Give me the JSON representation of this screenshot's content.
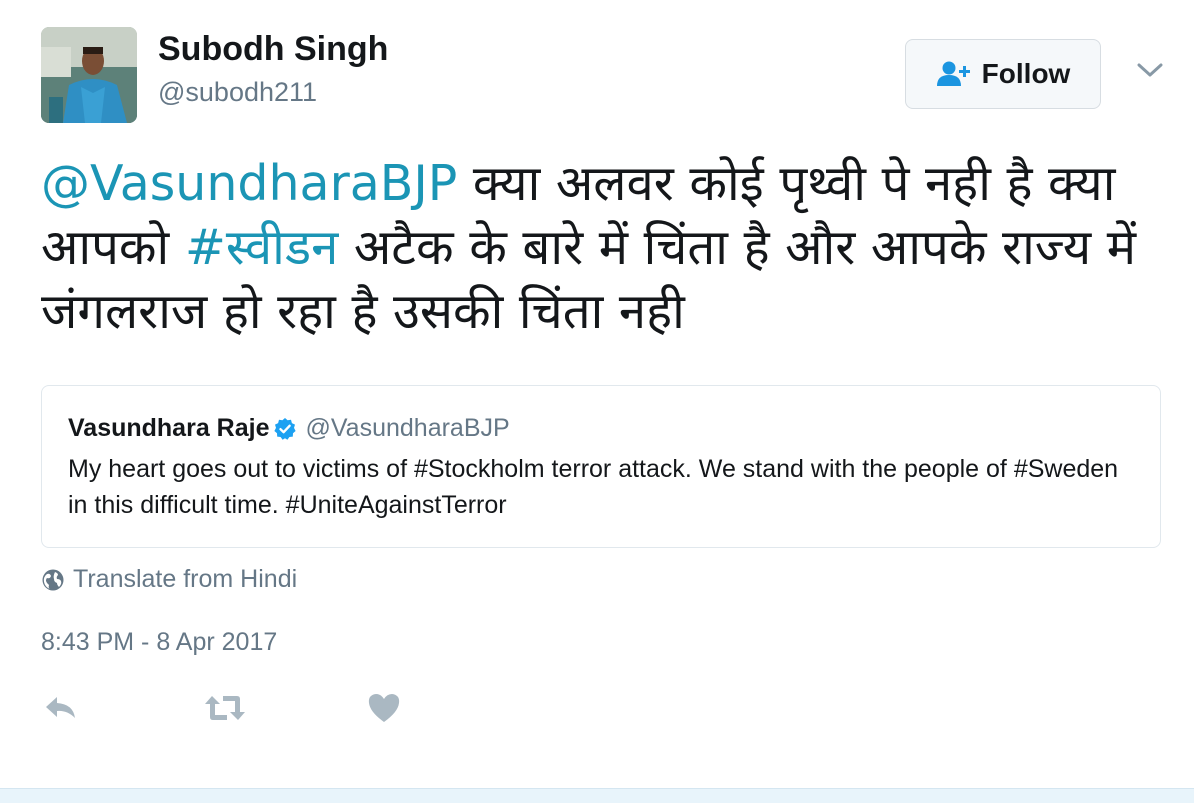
{
  "author": {
    "name": "Subodh Singh",
    "handle": "@subodh211"
  },
  "follow_button": {
    "label": "Follow",
    "icon": "add-user-icon"
  },
  "menu_icon": "chevron-down-icon",
  "tweet": {
    "mention": "@VasundharaBJP",
    "text_part1": " क्या अलवर कोई पृथ्वी पे नही है क्या आपको ",
    "hashtag": "#स्वीडन",
    "text_part2": " अटैक के बारे में चिंता है और आपके राज्य में जंगलराज हो रहा है उसकी चिंता नही"
  },
  "quoted_tweet": {
    "name": "Vasundhara Raje",
    "verified_icon": "verified-badge-icon",
    "handle": "@VasundharaBJP",
    "text": "My heart goes out to victims of #Stockholm terror attack. We stand with  the people of #Sweden in this difficult time. #UniteAgainstTerror"
  },
  "translate": {
    "icon": "globe-icon",
    "label": "Translate from Hindi"
  },
  "timestamp": "8:43 PM - 8 Apr 2017",
  "actions": [
    {
      "name": "reply",
      "icon": "reply-icon"
    },
    {
      "name": "retweet",
      "icon": "retweet-icon"
    },
    {
      "name": "like",
      "icon": "heart-icon"
    }
  ],
  "colors": {
    "link": "#1b95b5",
    "muted": "#657786",
    "text": "#14171a",
    "verified": "#1da1f2",
    "icon_gray": "#aab8c2"
  }
}
